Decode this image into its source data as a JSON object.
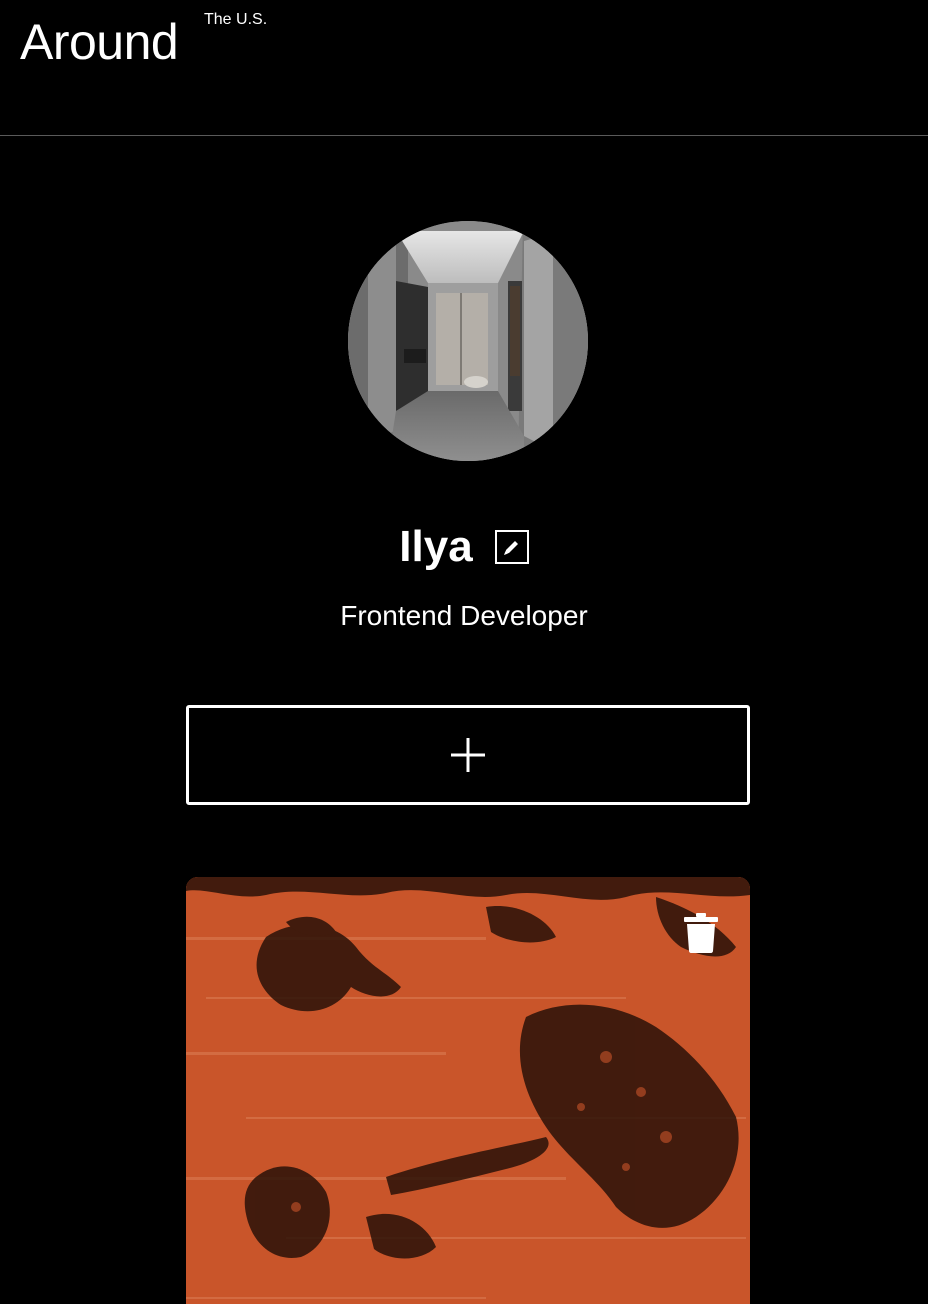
{
  "header": {
    "logo_text": "Around",
    "logo_superscript": "The U.S."
  },
  "profile": {
    "name": "Ilya",
    "job": "Frontend Developer",
    "avatar_icon": "avatar-photo-hallway",
    "edit_icon": "pencil-icon"
  },
  "add_button": {
    "icon": "plus-icon"
  },
  "cards": [
    {
      "image": "orange-abstract-painting",
      "delete_icon": "trash-icon"
    }
  ],
  "colors": {
    "background": "#000000",
    "text": "#ffffff",
    "divider": "#5a5a5a",
    "card_orange": "#c9552a"
  }
}
